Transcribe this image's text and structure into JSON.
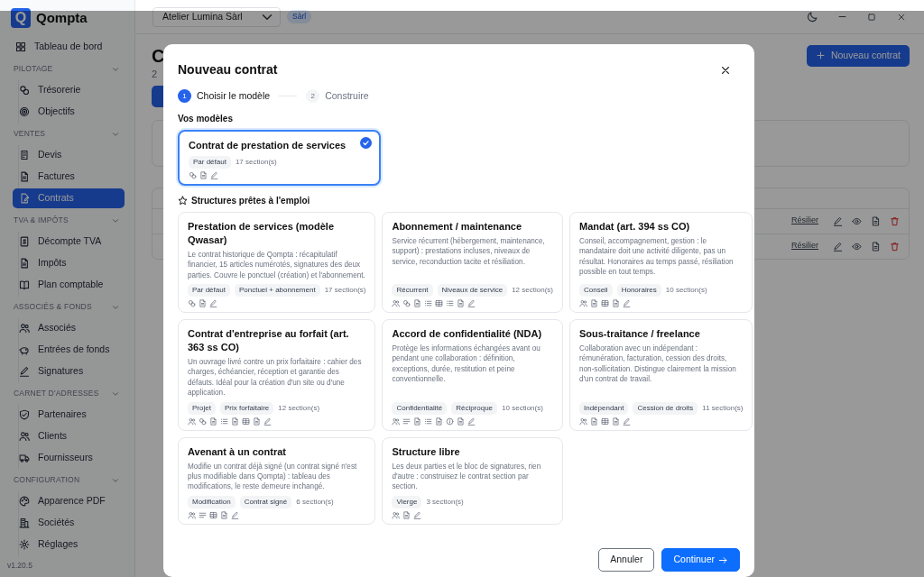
{
  "sidebar": {
    "logo_letter": "Q",
    "app_name": "Qompta",
    "items": [
      {
        "label": "Tableau de bord",
        "selected": false
      }
    ],
    "sections": [
      {
        "title": "PILOTAGE",
        "expanded": true,
        "items": [
          {
            "label": "Trésorerie",
            "selected": false
          },
          {
            "label": "Objectifs",
            "selected": false
          }
        ]
      },
      {
        "title": "VENTES",
        "expanded": true,
        "items": [
          {
            "label": "Devis",
            "selected": false
          },
          {
            "label": "Factures",
            "selected": false
          },
          {
            "label": "Contrats",
            "selected": true
          }
        ]
      },
      {
        "title": "TVA & IMPÔTS",
        "expanded": true,
        "items": [
          {
            "label": "Décompte TVA",
            "selected": false
          },
          {
            "label": "Impôts",
            "selected": false
          },
          {
            "label": "Plan comptable",
            "selected": false
          }
        ]
      },
      {
        "title": "ASSOCIÉS & FONDS",
        "expanded": true,
        "items": [
          {
            "label": "Associés",
            "selected": false
          },
          {
            "label": "Entrées de fonds",
            "selected": false
          },
          {
            "label": "Signatures",
            "selected": false
          }
        ]
      },
      {
        "title": "CARNET D'ADRESSES",
        "expanded": true,
        "items": [
          {
            "label": "Partenaires",
            "selected": false
          },
          {
            "label": "Clients",
            "selected": false
          },
          {
            "label": "Fournisseurs",
            "selected": false
          }
        ]
      },
      {
        "title": "CONFIGURATION",
        "expanded": true,
        "items": [
          {
            "label": "Apparence PDF",
            "selected": false
          },
          {
            "label": "Sociétés",
            "selected": false
          },
          {
            "label": "Réglages",
            "selected": false
          }
        ]
      }
    ],
    "version": "v1.20.5"
  },
  "header": {
    "company": "Atelier Lumina Sàrl",
    "company_type": "Sàrl"
  },
  "page": {
    "title": "C",
    "subtitle": "2",
    "new_button": "Nouveau contrat",
    "table": {
      "rows": [
        {
          "action": "Résilier"
        },
        {
          "action": "Résilier"
        }
      ]
    }
  },
  "modal": {
    "title": "Nouveau contrat",
    "steps": [
      {
        "number": "1",
        "label": "Choisir le modèle",
        "selected": true
      },
      {
        "number": "2",
        "label": "Construire",
        "selected": false
      }
    ],
    "my_templates_title": "Vos modèles",
    "my_templates": [
      {
        "title": "Contrat de prestation de services",
        "selected": true,
        "tags": [
          "Par défaut"
        ],
        "sections": "17 section(s)",
        "blocks": [
          {
            "kind": "attachment"
          },
          {
            "kind": "document"
          },
          {
            "kind": "signature"
          }
        ]
      }
    ],
    "ready_title": "Structures prêtes à l'emploi",
    "ready": [
      {
        "title": "Prestation de services (modèle Qwasar)",
        "selected": false,
        "description": "Le contrat historique de Qompta : récapitulatif financier, 15 articles numérotés, signatures des deux parties. Couvre le ponctuel (création) et l'abonnement.",
        "tags": [
          "Par défaut",
          "Ponctuel + abonnement"
        ],
        "sections": "17 section(s)",
        "blocks": [
          {
            "kind": "attachment"
          },
          {
            "kind": "document"
          },
          {
            "kind": "signature"
          }
        ]
      },
      {
        "title": "Abonnement / maintenance",
        "selected": false,
        "description": "Service récurrent (hébergement, maintenance, support) : prestations incluses, niveaux de service, reconduction tacite et résiliation.",
        "tags": [
          "Récurrent",
          "Niveaux de service"
        ],
        "sections": "12 section(s)",
        "blocks": [
          {
            "kind": "parties"
          },
          {
            "kind": "attachment"
          },
          {
            "kind": "document"
          },
          {
            "kind": "list"
          },
          {
            "kind": "table"
          },
          {
            "kind": "list"
          },
          {
            "kind": "document"
          },
          {
            "kind": "signature"
          }
        ]
      },
      {
        "title": "Mandat (art. 394 ss CO)",
        "selected": false,
        "description": "Conseil, accompagnement, gestion : le mandataire doit une activité diligente, pas un résultat. Honoraires au temps passé, résiliation possible en tout temps.",
        "tags": [
          "Conseil",
          "Honoraires"
        ],
        "sections": "10 section(s)",
        "blocks": [
          {
            "kind": "parties"
          },
          {
            "kind": "document"
          },
          {
            "kind": "table"
          },
          {
            "kind": "document"
          },
          {
            "kind": "signature"
          }
        ]
      },
      {
        "title": "Contrat d'entreprise au forfait (art. 363 ss CO)",
        "selected": false,
        "description": "Un ouvrage livré contre un prix forfaitaire : cahier des charges, échéancier, réception et garantie des défauts. Idéal pour la création d'un site ou d'une application.",
        "tags": [
          "Projet",
          "Prix forfaitaire"
        ],
        "sections": "12 section(s)",
        "blocks": [
          {
            "kind": "parties"
          },
          {
            "kind": "attachment"
          },
          {
            "kind": "document"
          },
          {
            "kind": "list"
          },
          {
            "kind": "document"
          },
          {
            "kind": "table"
          },
          {
            "kind": "document"
          },
          {
            "kind": "signature"
          }
        ]
      },
      {
        "title": "Accord de confidentialité (NDA)",
        "selected": false,
        "description": "Protège les informations échangées avant ou pendant une collaboration : définition, exceptions, durée, restitution et peine conventionnelle.",
        "tags": [
          "Confidentialité",
          "Réciproque"
        ],
        "sections": "10 section(s)",
        "blocks": [
          {
            "kind": "parties"
          },
          {
            "kind": "text"
          },
          {
            "kind": "document"
          },
          {
            "kind": "list"
          },
          {
            "kind": "document"
          },
          {
            "kind": "info"
          },
          {
            "kind": "document"
          },
          {
            "kind": "signature"
          }
        ]
      },
      {
        "title": "Sous-traitance / freelance",
        "selected": false,
        "description": "Collaboration avec un indépendant : rémunération, facturation, cession des droits, non-sollicitation. Distingue clairement la mission d'un contrat de travail.",
        "tags": [
          "Indépendant",
          "Cession de droits"
        ],
        "sections": "11 section(s)",
        "blocks": [
          {
            "kind": "parties"
          },
          {
            "kind": "document"
          },
          {
            "kind": "table"
          },
          {
            "kind": "document"
          },
          {
            "kind": "signature"
          }
        ]
      },
      {
        "title": "Avenant à un contrat",
        "selected": false,
        "description": "Modifie un contrat déjà signé (un contrat signé n'est plus modifiable dans Qompta) : tableau des modifications, le reste demeure inchangé.",
        "tags": [
          "Modification",
          "Contrat signé"
        ],
        "sections": "6 section(s)",
        "blocks": [
          {
            "kind": "parties"
          },
          {
            "kind": "text"
          },
          {
            "kind": "table"
          },
          {
            "kind": "document"
          },
          {
            "kind": "signature"
          }
        ]
      },
      {
        "title": "Structure libre",
        "selected": false,
        "description": "Les deux parties et le bloc de signatures, rien d'autre : construisez le contrat section par section.",
        "tags": [
          "Vierge"
        ],
        "sections": "3 section(s)",
        "blocks": [
          {
            "kind": "parties"
          },
          {
            "kind": "document"
          },
          {
            "kind": "signature"
          }
        ]
      }
    ],
    "cancel_button": "Annuler",
    "continue_button": "Continuer"
  }
}
